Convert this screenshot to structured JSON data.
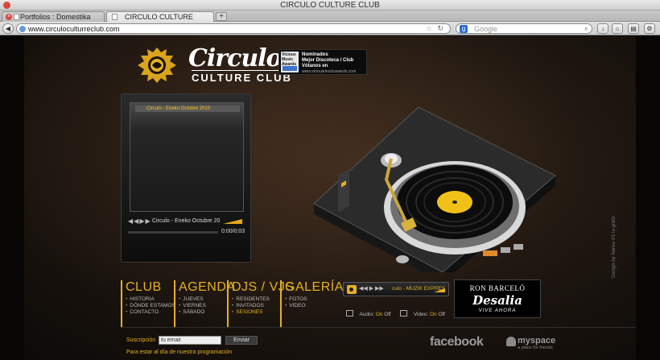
{
  "window": {
    "title": "CIRCULO CULTURE CLUB"
  },
  "tabs": [
    {
      "label": "Portfolios : Domestika"
    },
    {
      "label": "CIRCULO CULTURE CLUB"
    }
  ],
  "newtab": {
    "label": "+"
  },
  "address": {
    "url": "www.circuloculturreclub.com"
  },
  "search": {
    "placeholder": "Google"
  },
  "icons": {
    "back": "back-arrow-icon",
    "download": "download-icon",
    "home": "home-icon",
    "bookmarks": "bookmarks-icon",
    "settings": "gear-icon"
  },
  "colors": {
    "accent": "#e6b122",
    "background": "#1e1610"
  },
  "site": {
    "logo_script": "Circulo",
    "logo_sub": "CULTURE CLUB",
    "award": {
      "badge": "Vicious Music Awards",
      "line1": "Nominados",
      "line2": "Mejor Discoteca / Club",
      "line3": "Vótanos en",
      "line4": "www.viciousmusicawards.com"
    }
  },
  "player": {
    "playlist": [
      "Circulo - Eneko Octubre 2010"
    ],
    "now_playing": "Circulo - Eneko Octubre 20",
    "time": "0:00/0:03",
    "progress_fraction": 0.0,
    "controls": [
      "previous-icon",
      "play-icon",
      "next-icon"
    ]
  },
  "menu": [
    {
      "heading": "CLUB",
      "items": [
        {
          "label": "HISTORIA"
        },
        {
          "label": "DÓNDE ESTAMOS"
        },
        {
          "label": "CONTACTO"
        }
      ]
    },
    {
      "heading": "AGENDA",
      "items": [
        {
          "label": "JUEVES"
        },
        {
          "label": "VIERNES"
        },
        {
          "label": "SÁBADO"
        }
      ]
    },
    {
      "heading": "DJS / VJS",
      "items": [
        {
          "label": "RESIDENTES"
        },
        {
          "label": "INVITADOS"
        },
        {
          "label": "SESIONES"
        }
      ]
    },
    {
      "heading": "GALERÍA",
      "items": [
        {
          "label": "FOTOS"
        },
        {
          "label": "VIDEO"
        }
      ]
    }
  ],
  "radio": {
    "station": "culo - MUZIK EXPRES"
  },
  "toggles": {
    "audio_label": "Audio:",
    "audio_on": "On",
    "audio_off": "Off",
    "video_label": "Video:",
    "video_on": "On",
    "video_off": "Off"
  },
  "sponsor": {
    "ron": "RON BARCELÓ",
    "brand": "Desalia",
    "tagline": "VIVE AHORA"
  },
  "credits": "Design by Nerea VS la grafix",
  "footer": {
    "subscription_label": "Suscripción",
    "email_value": "tu email",
    "send_label": "Enviar",
    "note": "Para estar al día de nuestra programación",
    "facebook": "facebook",
    "myspace": "myspace",
    "myspace_tagline": "a place for friends"
  }
}
